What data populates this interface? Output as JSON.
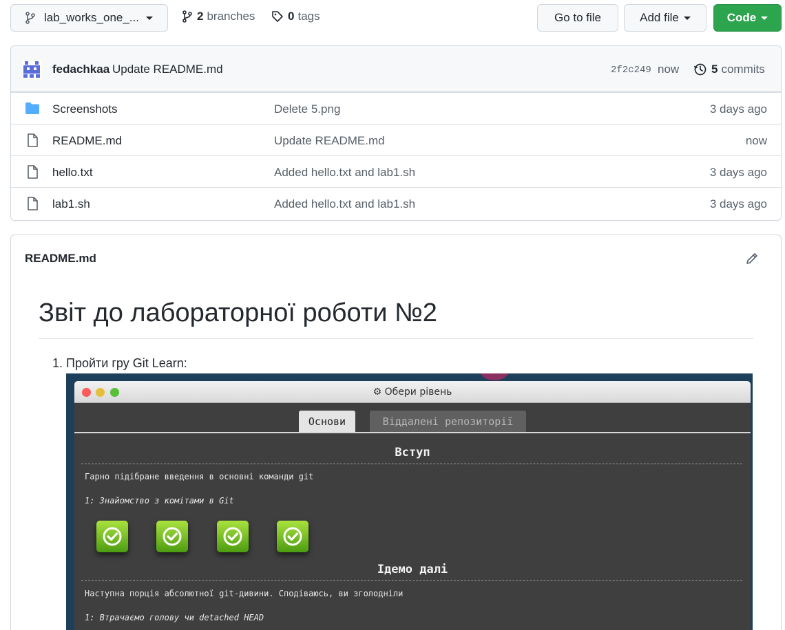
{
  "topbar": {
    "branch": "lab_works_one_...",
    "branches_count": "2",
    "branches_label": "branches",
    "tags_count": "0",
    "tags_label": "tags",
    "goto_file": "Go to file",
    "add_file": "Add file",
    "code": "Code"
  },
  "commit": {
    "author": "fedachkaa",
    "message": "Update README.md",
    "hash": "2f2c249",
    "time": "now",
    "count": "5",
    "count_label": "commits"
  },
  "files": [
    {
      "name": "Screenshots",
      "type": "folder",
      "commit": "Delete 5.png",
      "age": "3 days ago"
    },
    {
      "name": "README.md",
      "type": "file",
      "commit": "Update README.md",
      "age": "now"
    },
    {
      "name": "hello.txt",
      "type": "file",
      "commit": "Added hello.txt and lab1.sh",
      "age": "3 days ago"
    },
    {
      "name": "lab1.sh",
      "type": "file",
      "commit": "Added hello.txt and lab1.sh",
      "age": "3 days ago"
    }
  ],
  "readme": {
    "header": "README.md",
    "title": "Звіт до лабораторної роботи №2",
    "item_number": "1.",
    "item_text": "Пройти гру Git Learn:",
    "screenshot": {
      "window_title": "Обери рівень",
      "tab_active": "Основи",
      "tab_inactive": "Віддалені репозиторії",
      "section1_title": "Вступ",
      "section1_desc": "Гарно підібране введення в основні команди git",
      "section1_level": "1: Знайомство з комітами в Git",
      "section2_title": "Ідемо далі",
      "section2_desc": "Наступна порція абсолютної git-дивини. Сподіваюсь, ви зголодніли",
      "section2_level": "1: Втрачаємо голову чи detached HEAD"
    }
  },
  "colors": {
    "code_button": "#2da44e",
    "folder_icon": "#54aeff",
    "avatar": "#5a6dd8"
  },
  "icons": [
    "branch-icon",
    "tag-icon",
    "history-icon",
    "folder-icon",
    "file-icon",
    "pencil-icon",
    "check-icon"
  ]
}
